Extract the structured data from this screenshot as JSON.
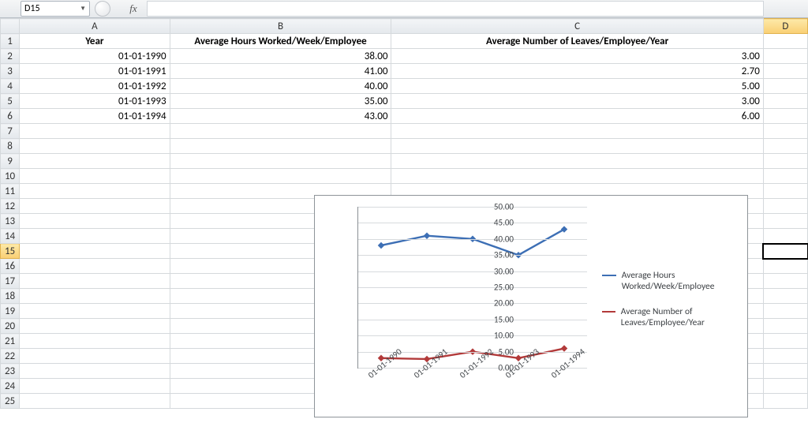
{
  "formula_bar": {
    "cell_ref": "D15",
    "fx_label": "fx",
    "formula": ""
  },
  "columns": {
    "A": "A",
    "B": "B",
    "C": "C",
    "D": "D"
  },
  "headers": {
    "A": "Year",
    "B": "Average Hours Worked/Week/Employee",
    "C": "Average Number of Leaves/Employee/Year"
  },
  "rows": [
    {
      "year": "01-01-1990",
      "hours": "38.00",
      "leaves": "3.00"
    },
    {
      "year": "01-01-1991",
      "hours": "41.00",
      "leaves": "2.70"
    },
    {
      "year": "01-01-1992",
      "hours": "40.00",
      "leaves": "5.00"
    },
    {
      "year": "01-01-1993",
      "hours": "35.00",
      "leaves": "3.00"
    },
    {
      "year": "01-01-1994",
      "hours": "43.00",
      "leaves": "6.00"
    }
  ],
  "selected_cell": "D15",
  "row_count": 25,
  "chart_data": {
    "type": "line",
    "categories": [
      "01-01-1990",
      "01-01-1991",
      "01-01-1992",
      "01-01-1993",
      "01-01-1994"
    ],
    "series": [
      {
        "name": "Average Hours Worked/Week/Employee",
        "values": [
          38.0,
          41.0,
          40.0,
          35.0,
          43.0
        ],
        "color": "#3d6fb5"
      },
      {
        "name": "Average Number of Leaves/Employee/Year",
        "values": [
          3.0,
          2.7,
          5.0,
          3.0,
          6.0
        ],
        "color": "#b23a3a"
      }
    ],
    "ylim": [
      0,
      50
    ],
    "ystep": 5,
    "xlabel": "",
    "ylabel": "",
    "title": ""
  }
}
